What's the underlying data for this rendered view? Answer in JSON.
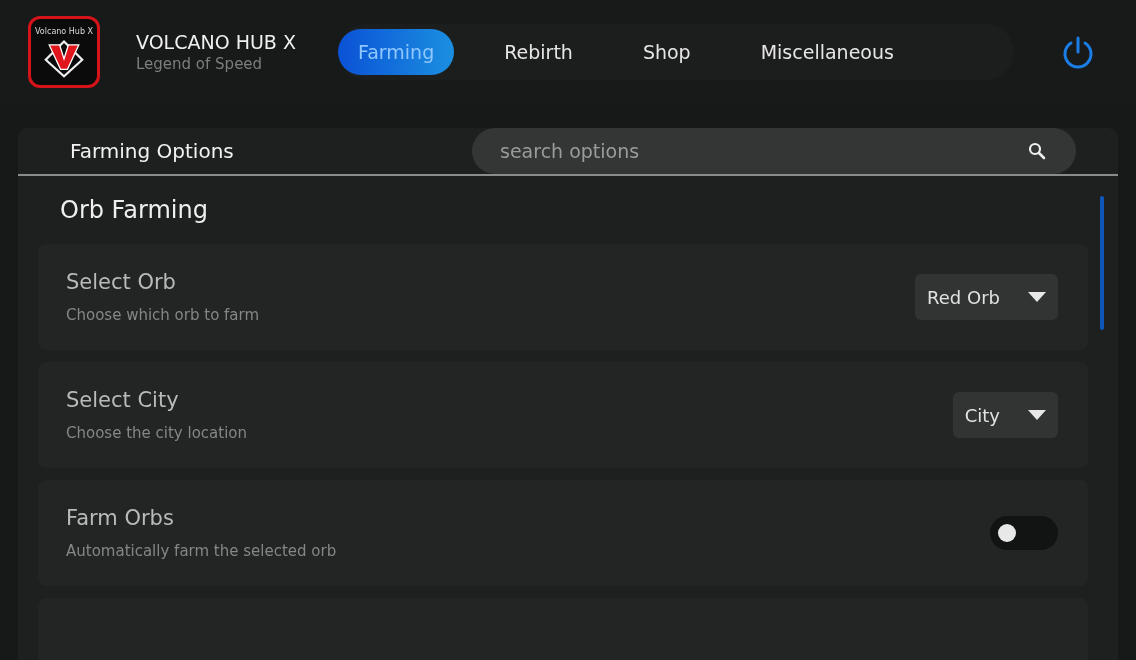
{
  "header": {
    "logo_text": "Volcano Hub X",
    "title": "VOLCANO HUB X",
    "subtitle": "Legend of Speed"
  },
  "tabs": [
    {
      "label": "Farming",
      "selected": true
    },
    {
      "label": "Rebirth",
      "selected": false
    },
    {
      "label": "Shop",
      "selected": false
    },
    {
      "label": "Miscellaneous",
      "selected": false
    }
  ],
  "panel": {
    "title": "Farming Options",
    "search": {
      "placeholder": "search options"
    }
  },
  "section": {
    "title": "Orb Farming"
  },
  "options": [
    {
      "kind": "dropdown",
      "label": "Select Orb",
      "description": "Choose which orb to farm",
      "value": "Red Orb"
    },
    {
      "kind": "dropdown",
      "label": "Select City",
      "description": "Choose the city location",
      "value": "City"
    },
    {
      "kind": "toggle",
      "label": "Farm Orbs",
      "description": "Automatically farm the selected orb",
      "on": false
    }
  ]
}
